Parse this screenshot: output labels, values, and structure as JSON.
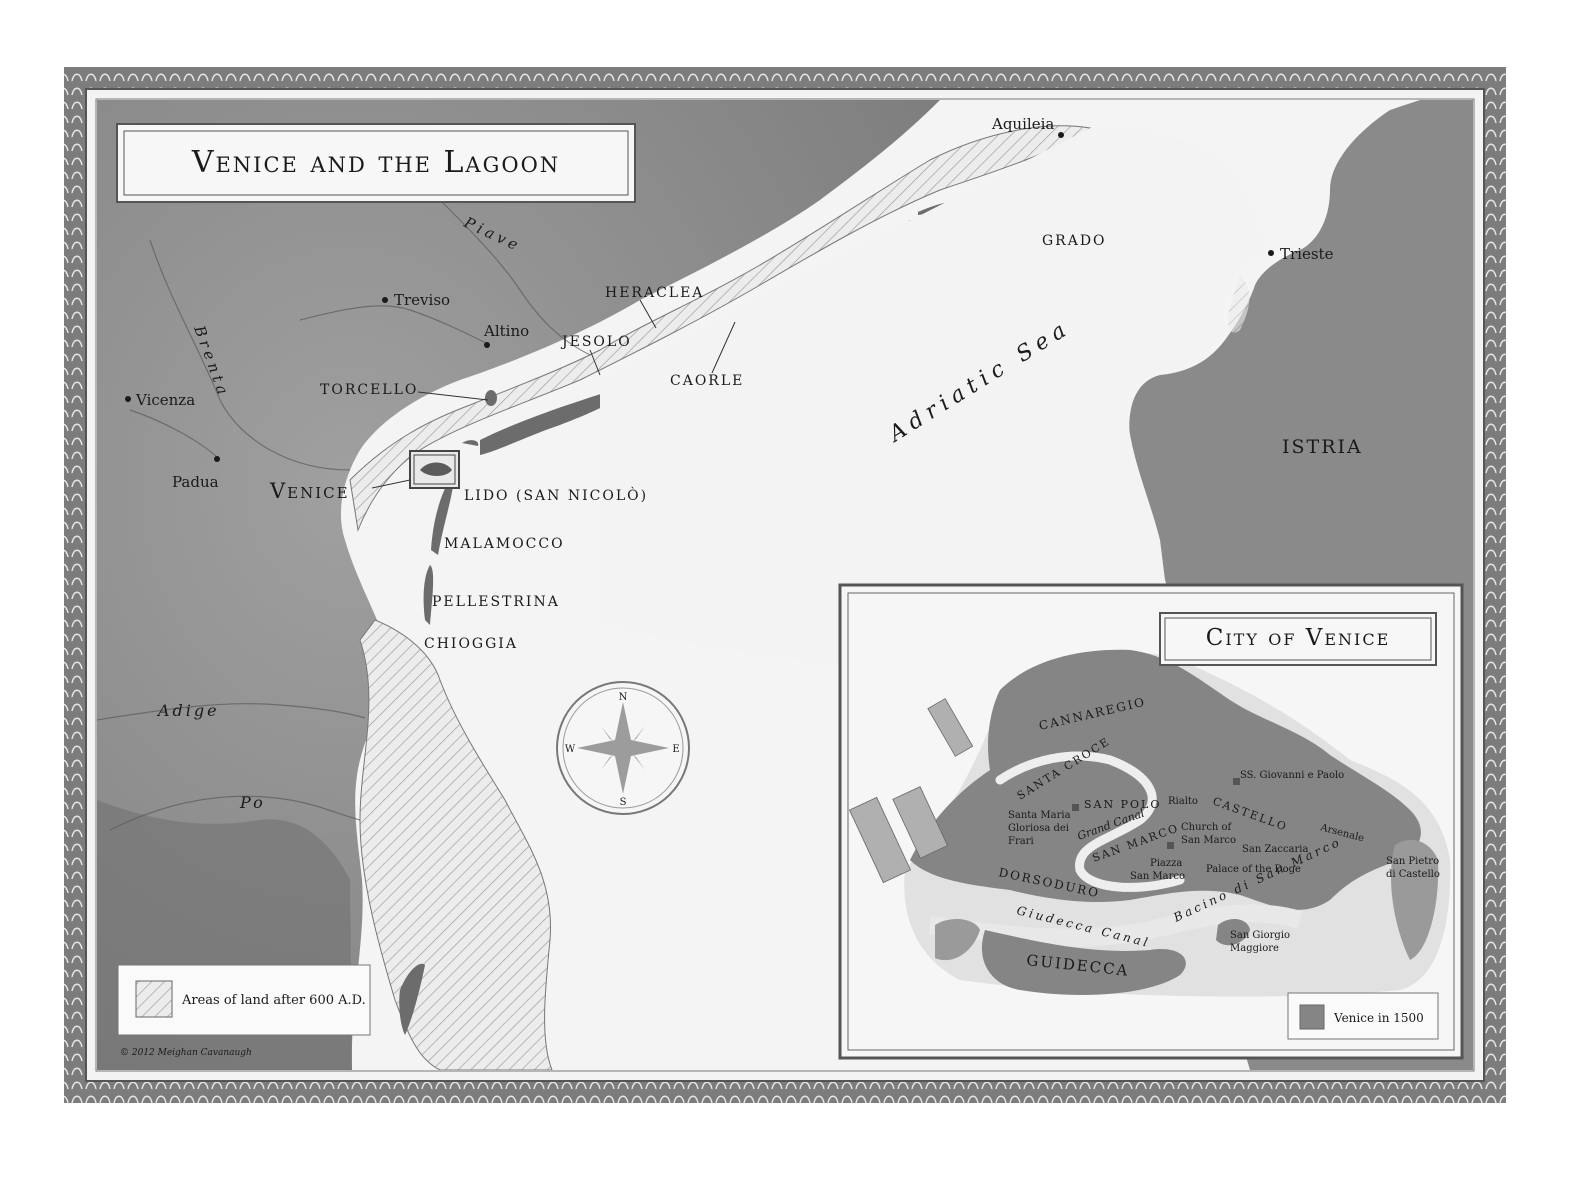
{
  "main_map": {
    "title": "Venice and the Lagoon",
    "colors": {
      "land": "#8f8f8f",
      "land_dark": "#7a7a7a",
      "sea": "#f2f2f2",
      "border": "#6e6e6e",
      "ink": "#1a1a1a"
    },
    "cities": {
      "aquileia": "Aquileia",
      "trieste": "Trieste",
      "treviso": "Treviso",
      "altino": "Altino",
      "vicenza": "Vicenza",
      "padua": "Padua"
    },
    "places": {
      "grado": "GRADO",
      "heraclea": "HERACLEA",
      "jesolo": "JESOLO",
      "caorle": "CAORLE",
      "torcello": "TORCELLO",
      "venice": "Venice",
      "lido": "LIDO (SAN NICOLÒ)",
      "malamocco": "MALAMOCCO",
      "pellestrina": "PELLESTRINA",
      "chioggia": "CHIOGGIA",
      "istria": "ISTRIA"
    },
    "water": {
      "adriatic": "Adriatic Sea",
      "piave": "Piave",
      "brenta": "Brenta",
      "adige": "Adige",
      "po": "Po"
    },
    "compass": {
      "n": "N",
      "s": "S",
      "e": "E",
      "w": "W"
    },
    "legend": {
      "label": "Areas of land after 600 A.D."
    },
    "copyright": "© 2012 Meighan Cavanaugh"
  },
  "inset": {
    "title": "City of Venice",
    "districts": {
      "cannaregio": "CANNAREGIO",
      "santa_croce": "SANTA CROCE",
      "san_polo": "SAN POLO",
      "castello": "CASTELLO",
      "san_marco": "SAN MARCO",
      "dorsoduro": "DORSODURO",
      "guidecca": "GUIDECCA"
    },
    "sites": {
      "ss_giovanni": "SS. Giovanni e Paolo",
      "rialto": "Rialto",
      "frari_1": "Santa Maria",
      "frari_2": "Gloriosa dei",
      "frari_3": "Frari",
      "church_1": "Church of",
      "church_2": "San Marco",
      "san_zaccaria": "San Zaccaria",
      "arsenale": "Arsenale",
      "san_pietro_1": "San Pietro",
      "san_pietro_2": "di Castello",
      "piazza_1": "Piazza",
      "piazza_2": "San Marco",
      "palace": "Palace of the Doge",
      "san_giorgio_1": "San Giorgio",
      "san_giorgio_2": "Maggiore"
    },
    "waterways": {
      "grand_canal": "Grand Canal",
      "giudecca_canal": "Giudecca Canal",
      "bacino": "Bacino di San Marco"
    },
    "legend": {
      "label": "Venice in 1500"
    }
  }
}
